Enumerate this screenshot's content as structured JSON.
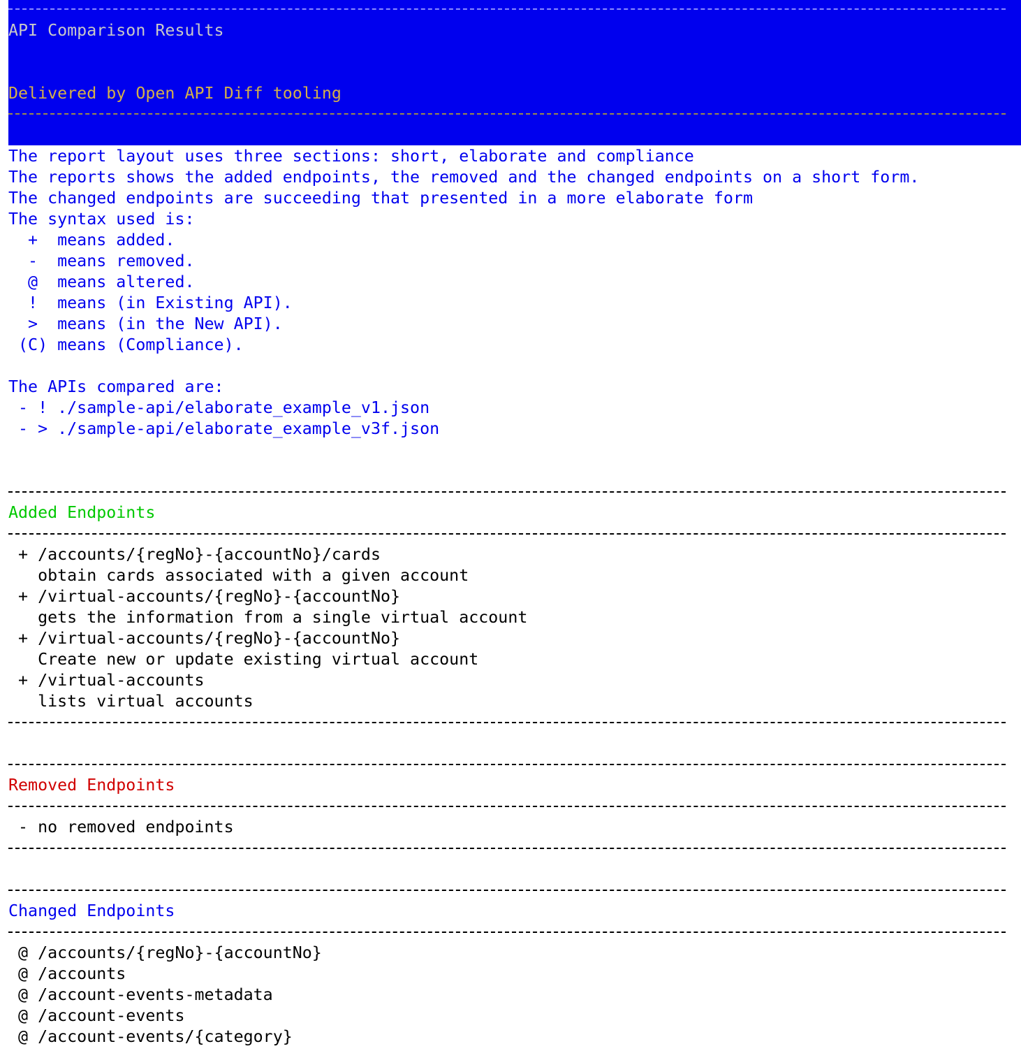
{
  "header": {
    "title": "API Comparison Results",
    "subtitle": "Delivered by Open API Diff tooling"
  },
  "intro": {
    "lines": [
      "The report layout uses three sections: short, elaborate and compliance",
      "The reports shows the added endpoints, the removed and the changed endpoints on a short form.",
      "The changed endpoints are succeeding that presented in a more elaborate form",
      "The syntax used is:"
    ],
    "legend": [
      "  +  means added.",
      "  -  means removed.",
      "  @  means altered.",
      "  !  means (in Existing API).",
      "  >  means (in the New API).",
      " (C) means (Compliance)."
    ],
    "apis_heading": "The APIs compared are:",
    "apis": [
      " - ! ./sample-api/elaborate_example_v1.json",
      " - > ./sample-api/elaborate_example_v3f.json"
    ]
  },
  "added": {
    "heading": "Added Endpoints",
    "lines": [
      " + /accounts/{regNo}-{accountNo}/cards",
      "   obtain cards associated with a given account",
      " + /virtual-accounts/{regNo}-{accountNo}",
      "   gets the information from a single virtual account",
      " + /virtual-accounts/{regNo}-{accountNo}",
      "   Create new or update existing virtual account",
      " + /virtual-accounts",
      "   lists virtual accounts"
    ]
  },
  "removed": {
    "heading": "Removed Endpoints",
    "lines": [
      " - no removed endpoints"
    ]
  },
  "changed": {
    "heading": "Changed Endpoints",
    "lines": [
      " @ /accounts/{regNo}-{accountNo}",
      " @ /accounts",
      " @ /account-events-metadata",
      " @ /account-events",
      " @ /account-events/{category}"
    ]
  },
  "colors": {
    "banner": "#0000ee",
    "title": "#c8c8c8",
    "subtitle": "#d4b04a",
    "intro_text": "#0000ee",
    "added_heading": "#00c800",
    "removed_heading": "#d00000",
    "changed_heading": "#0000ee"
  }
}
